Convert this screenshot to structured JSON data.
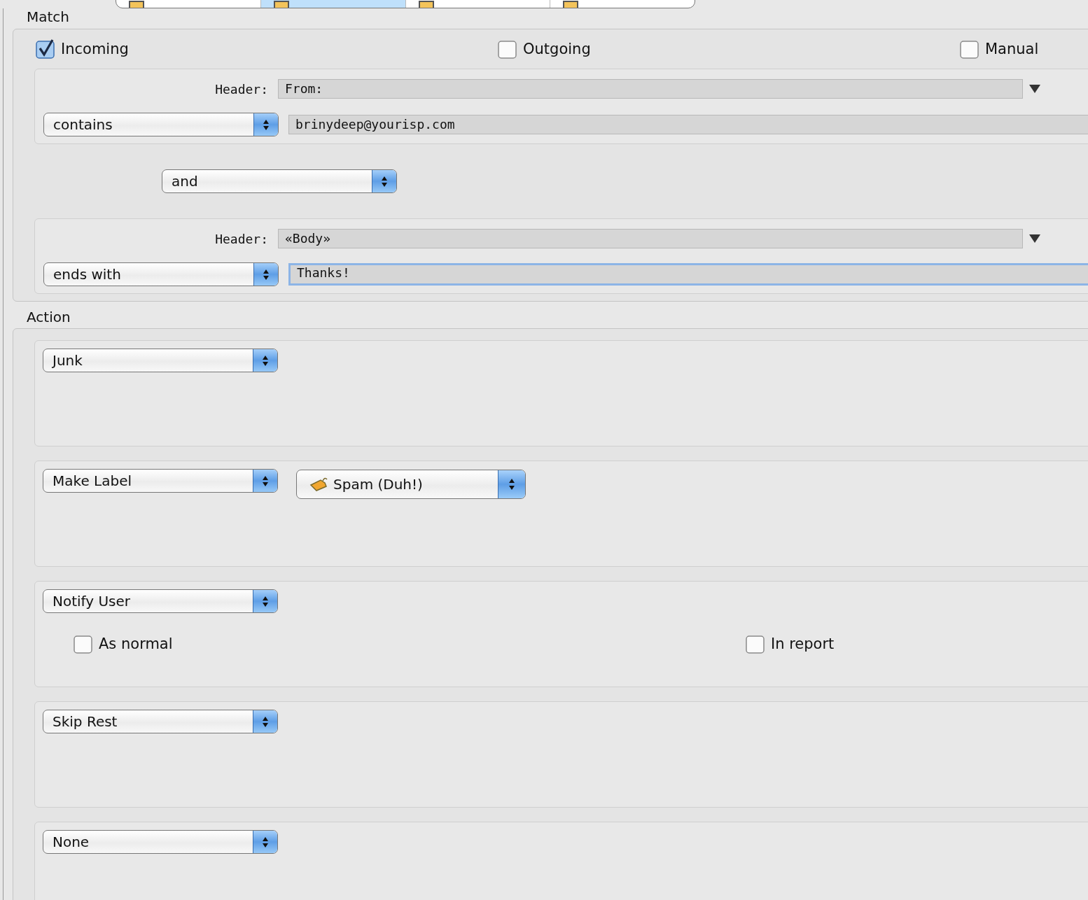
{
  "tabs": [
    {
      "selected": false
    },
    {
      "selected": true
    },
    {
      "selected": false
    },
    {
      "selected": false
    }
  ],
  "match": {
    "title": "Match",
    "directions": [
      {
        "label": "Incoming",
        "checked": true
      },
      {
        "label": "Outgoing",
        "checked": false
      },
      {
        "label": "Manual",
        "checked": false
      }
    ],
    "conditions": [
      {
        "header_label": "Header:",
        "header": "From:",
        "operator": "contains",
        "value": "brinydeep@yourisp.com",
        "focused": false
      },
      {
        "header_label": "Header:",
        "header": "«Body»",
        "operator": "ends with",
        "value": "Thanks!",
        "focused": true
      }
    ],
    "conjunction": "and"
  },
  "action": {
    "title": "Action",
    "actions": [
      {
        "kind": "plain",
        "action": "Junk"
      },
      {
        "kind": "label",
        "action": "Make Label",
        "label": "Spam (Duh!)"
      },
      {
        "kind": "notify",
        "action": "Notify User",
        "options": [
          {
            "label": "As normal",
            "checked": false
          },
          {
            "label": "In report",
            "checked": false
          }
        ]
      },
      {
        "kind": "plain",
        "action": "Skip Rest"
      },
      {
        "kind": "plain",
        "action": "None"
      }
    ]
  }
}
